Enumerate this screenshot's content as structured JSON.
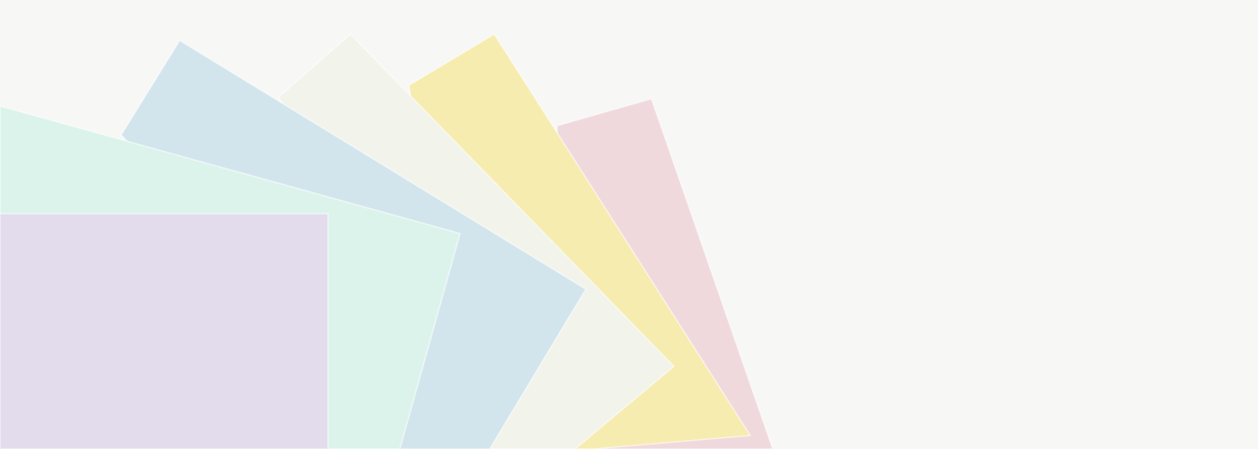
{
  "scene": {
    "background": "#f7f7f5",
    "description_visible_text": ""
  },
  "papers": [
    {
      "name": "paper-sheet-pink",
      "color": "#f0d9dd"
    },
    {
      "name": "paper-sheet-yellow",
      "color": "#f6ecb0"
    },
    {
      "name": "paper-sheet-cream",
      "color": "#f2f3ea"
    },
    {
      "name": "paper-sheet-blue",
      "color": "#d3e5ec"
    },
    {
      "name": "paper-sheet-mint",
      "color": "#dcf3ec"
    },
    {
      "name": "paper-sheet-lavender",
      "color": "#e3dcec"
    }
  ]
}
